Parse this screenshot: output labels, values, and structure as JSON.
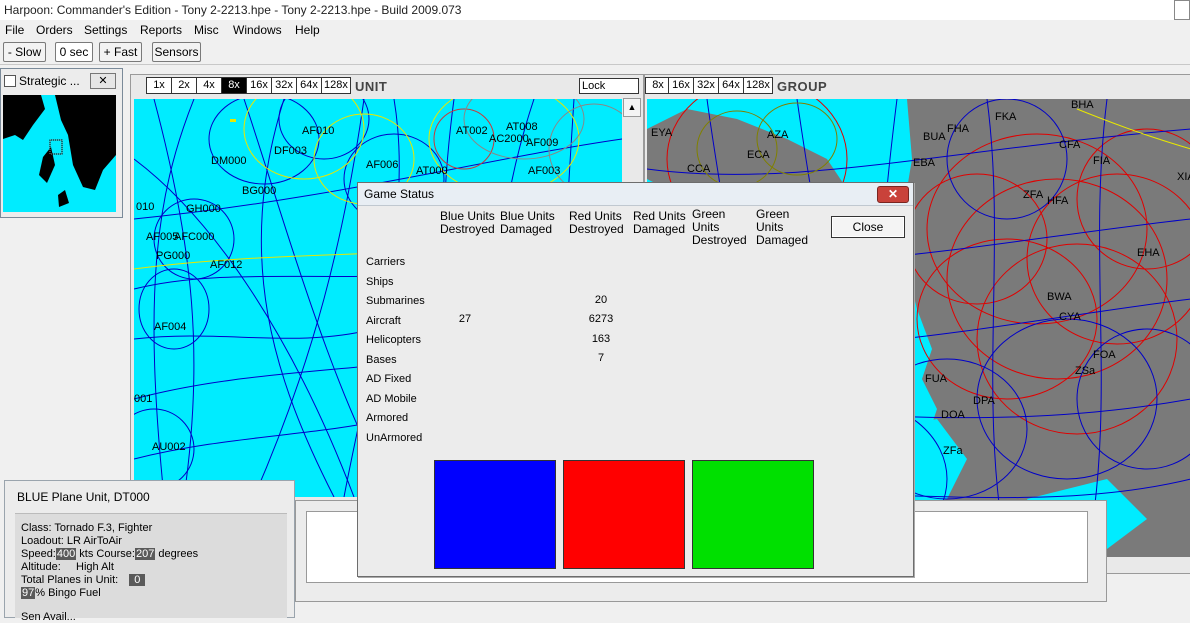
{
  "window": {
    "title": "Harpoon: Commander's Edition - Tony 2-2213.hpe - Tony 2-2213.hpe - Build 2009.073"
  },
  "menu": [
    "File",
    "Orders",
    "Settings",
    "Reports",
    "Misc",
    "Windows",
    "Help"
  ],
  "toolbar": {
    "slow": "- Slow",
    "time": "0 sec",
    "fast": "+ Fast",
    "sensors": "Sensors"
  },
  "strategic": {
    "title": "Strategic ...",
    "close": "✕"
  },
  "unit_panel": {
    "title": "UNIT",
    "zoom": [
      "1x",
      "2x",
      "4x",
      "8x",
      "16x",
      "32x",
      "64x",
      "128x"
    ],
    "selected_zoom": "8x",
    "lock_value": "Lock",
    "labels": [
      "AF010",
      "AT002",
      "AT008",
      "AC2000",
      "AF009",
      "DM000",
      "DF003",
      "AF006",
      "AT000",
      "AF003",
      "BG000",
      "GH000",
      "AF005",
      "AFC000",
      "PG000",
      "AF012",
      "AF004",
      "AU002",
      "001",
      "010"
    ]
  },
  "group_panel": {
    "title": "GROUP",
    "zoom": [
      "8x",
      "16x",
      "32x",
      "64x",
      "128x"
    ],
    "labels": [
      "BHA",
      "FHA",
      "FKA",
      "EYA",
      "AZA",
      "BUA",
      "ECA",
      "CCA",
      "EBA",
      "FIA",
      "XIA",
      "CFA",
      "ZFA",
      "HFA",
      "EHA",
      "BWA",
      "CYA",
      "FOA",
      "ZSa",
      "FUA",
      "DOA",
      "DPA",
      "ZFa"
    ]
  },
  "game_status": {
    "title": "Game Status",
    "close_x": "✕",
    "close_label": "Close",
    "columns": [
      [
        "Blue Units",
        "Destroyed"
      ],
      [
        "Blue Units",
        "Damaged"
      ],
      [
        "Red Units",
        "Destroyed"
      ],
      [
        "Red Units",
        "Damaged"
      ],
      [
        "Green",
        "Units",
        "Destroyed"
      ],
      [
        "Green",
        "Units",
        "Damaged"
      ]
    ],
    "rows": [
      "Carriers",
      "Ships",
      "Submarines",
      "Aircraft",
      "Helicopters",
      "Bases",
      "AD Fixed",
      "AD Mobile",
      "Armored",
      "UnArmored"
    ],
    "values": {
      "blue_destroyed": [
        "",
        "",
        "",
        "27",
        "",
        "",
        "",
        "",
        "",
        ""
      ],
      "red_destroyed": [
        "",
        "",
        "20",
        "6273",
        "163",
        "7",
        "",
        "",
        "",
        ""
      ]
    },
    "swatch_colors": [
      "#0000ff",
      "#ff0000",
      "#00e000"
    ]
  },
  "unit_info": {
    "header": "BLUE Plane Unit, DT000",
    "class_line": "Class: Tornado F.3, Fighter",
    "loadout_line": "Loadout: LR AirToAir",
    "speed_label": "Speed:",
    "speed_value": "400",
    "speed_unit": "kts",
    "course_label": "Course:",
    "course_value": "207",
    "course_unit": "degrees",
    "altitude_line": "Altitude:     High Alt",
    "total_label": "Total Planes in Unit:",
    "total_value": "0",
    "fuel_value": "97",
    "fuel_unit": "% Bingo Fuel",
    "cut_line": "Sen Avail..."
  }
}
